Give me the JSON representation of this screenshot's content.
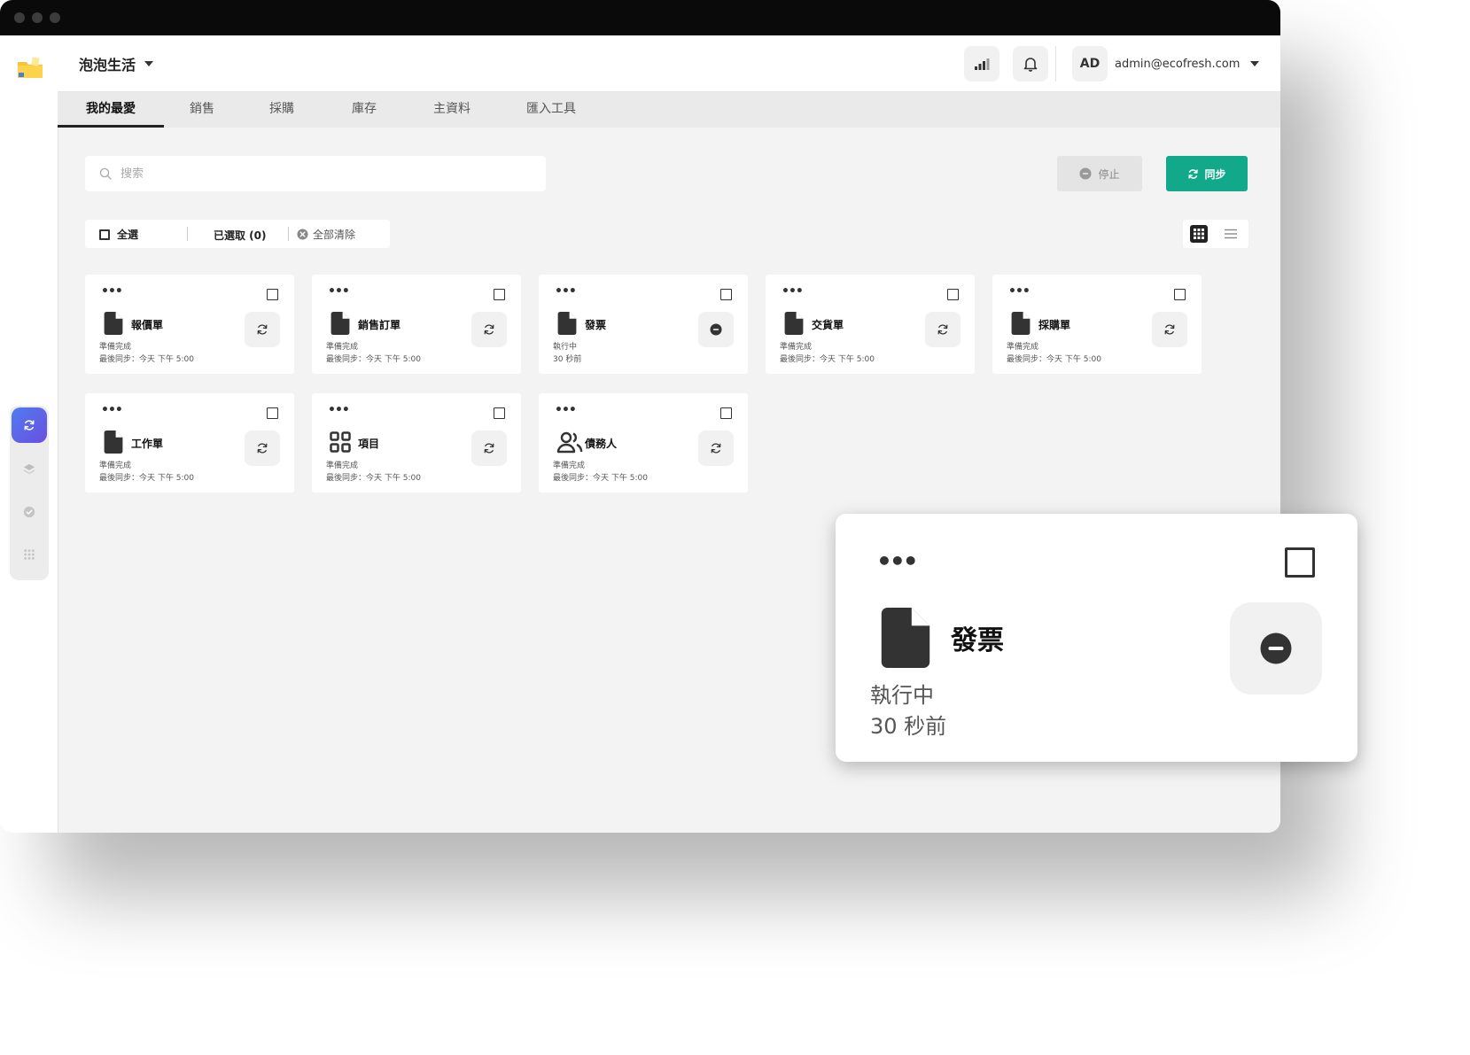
{
  "header": {
    "org_name": "泡泡生活",
    "avatar_initials": "AD",
    "user_email": "admin@ecofresh.com"
  },
  "tabs": [
    {
      "label": "我的最愛",
      "active": true
    },
    {
      "label": "銷售",
      "active": false
    },
    {
      "label": "採購",
      "active": false
    },
    {
      "label": "庫存",
      "active": false
    },
    {
      "label": "主資料",
      "active": false
    },
    {
      "label": "匯入工具",
      "active": false
    }
  ],
  "toolbar": {
    "search_placeholder": "搜索",
    "stop_label": "停止",
    "sync_label": "同步"
  },
  "selection": {
    "select_all_label": "全選",
    "selected_label": "已選取 (0)",
    "clear_all_label": "全部清除"
  },
  "cards": [
    {
      "title": "報價單",
      "status": "準備完成",
      "time": "最後同步：今天 下午 5:00",
      "icon": "document-icon",
      "action": "sync"
    },
    {
      "title": "銷售訂單",
      "status": "準備完成",
      "time": "最後同步：今天 下午 5:00",
      "icon": "document-icon",
      "action": "sync"
    },
    {
      "title": "發票",
      "status": "執行中",
      "time": "30 秒前",
      "icon": "document-icon",
      "action": "stop"
    },
    {
      "title": "交貨單",
      "status": "準備完成",
      "time": "最後同步：今天 下午 5:00",
      "icon": "document-icon",
      "action": "sync"
    },
    {
      "title": "採購單",
      "status": "準備完成",
      "time": "最後同步：今天 下午 5:00",
      "icon": "document-icon",
      "action": "sync"
    },
    {
      "title": "工作單",
      "status": "準備完成",
      "time": "最後同步：今天 下午 5:00",
      "icon": "document-icon",
      "action": "sync"
    },
    {
      "title": "項目",
      "status": "準備完成",
      "time": "最後同步：今天 下午 5:00",
      "icon": "grid-icon",
      "action": "sync"
    },
    {
      "title": "債務人",
      "status": "準備完成",
      "time": "最後同步：今天 下午 5:00",
      "icon": "users-icon",
      "action": "sync"
    }
  ],
  "zoom_card": {
    "title": "發票",
    "status": "執行中",
    "time": "30 秒前"
  },
  "colors": {
    "sync_button": "#12a98a",
    "active_rail": "#5a6ae8",
    "titlebar": "#0a0a0a"
  }
}
